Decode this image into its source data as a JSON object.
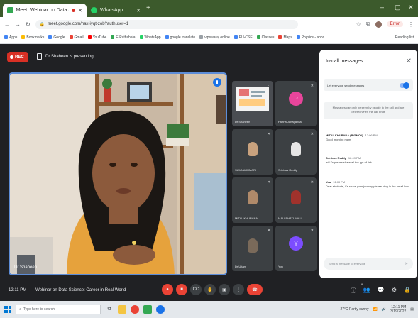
{
  "browser": {
    "tabs": [
      {
        "label": "Meet: Webinar on Data S",
        "active": true
      },
      {
        "label": "WhatsApp",
        "active": false
      }
    ],
    "address": "meet.google.com/hax-iyqt-zob?authuser=1",
    "update_label": "Error",
    "bookmarks": [
      "Apps",
      "Bookmarks",
      "Google",
      "Gmail",
      "YouTube",
      "E-Pathshala",
      "WhatsApp",
      "google translate",
      "vipswaraj.online",
      "PU-CSE",
      "Classes",
      "Maps",
      "Physics - apps"
    ],
    "reading_list": "Reading list"
  },
  "meet": {
    "rec_label": "REC",
    "presenting": "Dr Shaheen is presenting",
    "main_speaker": "Dr Shaheen",
    "participants": [
      {
        "name": "Dr Shaheen",
        "kind": "screen",
        "color": "#4a4d52"
      },
      {
        "name": "Partha Janaganna",
        "kind": "avatar",
        "initial": "P",
        "color": "#e8459b"
      },
      {
        "name": "SUMNAKUMARI",
        "kind": "video",
        "color": "#2c2f33"
      },
      {
        "name": "Srinivas Reddy",
        "kind": "video",
        "color": "#2f3236"
      },
      {
        "name": "MITAL KHURANA",
        "kind": "video",
        "color": "#35332f"
      },
      {
        "name": "MALI BHATI WALI",
        "kind": "video",
        "color": "#3a2e2e"
      },
      {
        "name": "Dr Uttam",
        "kind": "video",
        "color": "#38352f"
      },
      {
        "name": "You",
        "kind": "avatar",
        "initial": "Y",
        "color": "#7c4dff"
      }
    ],
    "meeting_time": "12:11 PM",
    "meeting_title": "Webinar on Data Science: Career in Real World",
    "participant_count": "9"
  },
  "chat": {
    "title": "In-call messages",
    "toggle_label": "Let everyone send messages",
    "notice": "Messages can only be seen by people in the call and are deleted when the call ends",
    "messages": [
      {
        "sender": "MITAL KHURANA (BIGMO1)",
        "time": "12:06 PM",
        "text": "Good morning mam"
      },
      {
        "sender": "Srinivas Reddy",
        "time": "12:09 PM",
        "text": "will Dr please share all the ppt of link"
      },
      {
        "sender": "You",
        "time": "12:09 PM",
        "text": "Dear students, it's share your journey please ping in the email box"
      }
    ],
    "input_placeholder": "Send a message to everyone"
  },
  "taskbar": {
    "search_placeholder": "Type here to search",
    "weather": "27°C Partly sunny",
    "time": "12:11 PM",
    "date": "3/19/2022"
  },
  "colors": {
    "meet_bg": "#202124",
    "tab_bar": "#3c5a2c",
    "accent": "#1a73e8",
    "danger": "#ea4335"
  }
}
